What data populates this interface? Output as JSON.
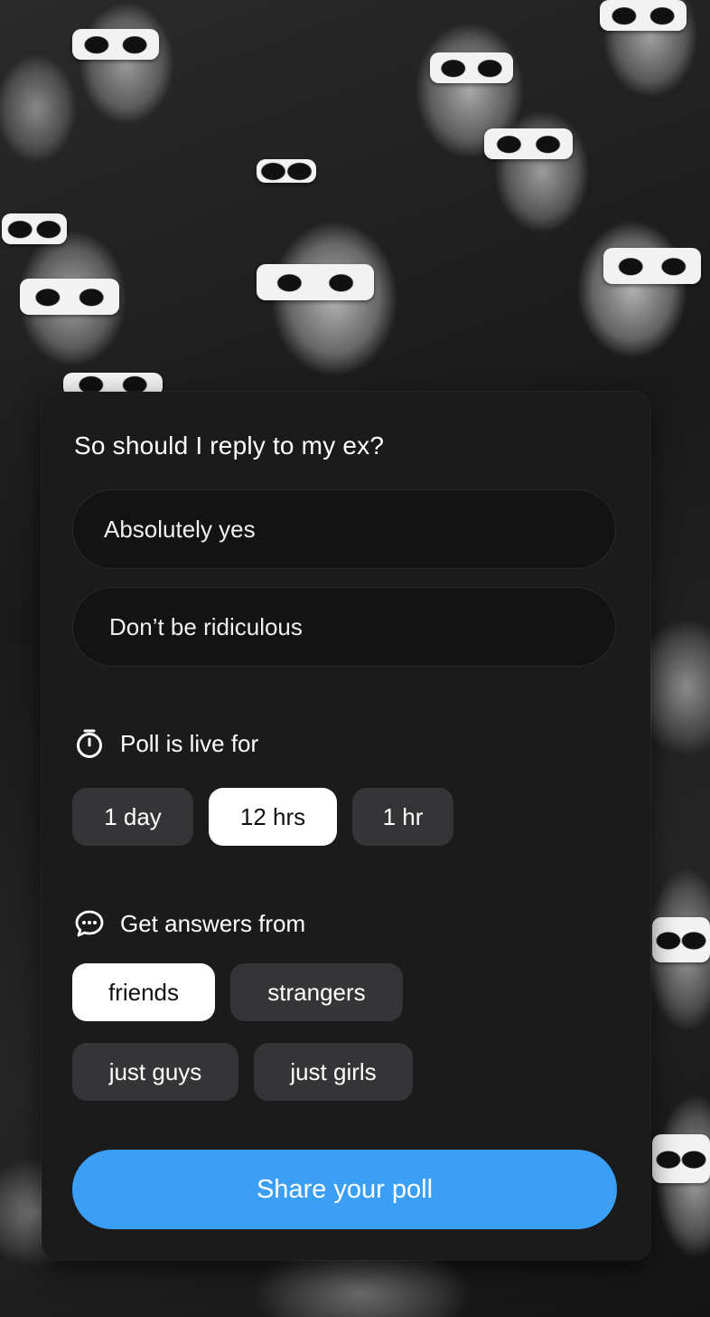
{
  "poll": {
    "question": "So should I reply to my ex?",
    "options": [
      {
        "text": "Absolutely yes"
      },
      {
        "text": "Don’t be ridiculous"
      }
    ]
  },
  "duration": {
    "heading": "Poll is live for",
    "icon": "stopwatch-icon",
    "choices": [
      {
        "label": "1 day",
        "selected": false
      },
      {
        "label": "12 hrs",
        "selected": true
      },
      {
        "label": "1 hr",
        "selected": false
      }
    ]
  },
  "audience": {
    "heading": "Get answers from",
    "icon": "chat-bubble-icon",
    "choices": [
      {
        "label": "friends",
        "selected": true
      },
      {
        "label": "strangers",
        "selected": false
      },
      {
        "label": "just guys",
        "selected": false
      },
      {
        "label": "just girls",
        "selected": false
      }
    ]
  },
  "share": {
    "label": "Share your poll"
  },
  "colors": {
    "panel": "#1b1b1c",
    "chip": "#353537",
    "chip_selected": "#ffffff",
    "accent": "#3a9ff5"
  }
}
